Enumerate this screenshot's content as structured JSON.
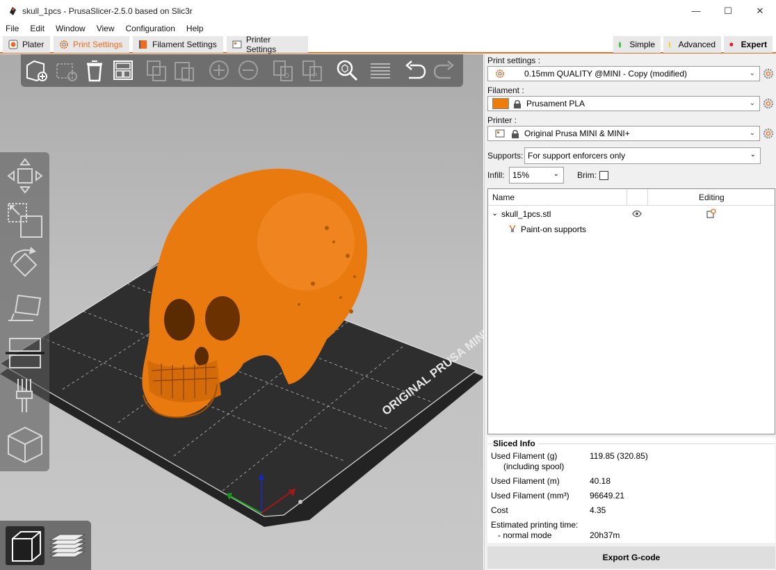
{
  "window": {
    "title": "skull_1pcs - PrusaSlicer-2.5.0 based on Slic3r",
    "minimize": "—",
    "maximize": "☐",
    "close": "✕"
  },
  "menu": [
    "File",
    "Edit",
    "Window",
    "View",
    "Configuration",
    "Help"
  ],
  "tabs": {
    "plater": "Plater",
    "print_settings": "Print Settings",
    "filament_settings": "Filament Settings",
    "printer_settings": "Printer Settings"
  },
  "modes": {
    "simple": "Simple",
    "advanced": "Advanced",
    "expert": "Expert",
    "colors": {
      "simple": "#3ec43e",
      "advanced": "#f2d21b",
      "expert": "#e01b24"
    }
  },
  "bed": {
    "label": "ORIGINAL PRUSA MINI"
  },
  "panel": {
    "print_settings_label": "Print settings :",
    "print_settings_value": "0.15mm QUALITY @MINI - Copy (modified)",
    "filament_label": "Filament :",
    "filament_value": "Prusament PLA",
    "filament_color": "#ed7d0a",
    "printer_label": "Printer :",
    "printer_value": "Original Prusa MINI & MINI+",
    "supports_label": "Supports:",
    "supports_value": "For support enforcers only",
    "infill_label": "Infill:",
    "infill_value": "15%",
    "brim_label": "Brim:",
    "brim_checked": false
  },
  "objects": {
    "col_name": "Name",
    "col_editing": "Editing",
    "items": [
      {
        "name": "skull_1pcs.stl",
        "icon": "eye-icon"
      },
      {
        "name": "Paint-on supports",
        "icon": "paint-supports-icon"
      }
    ]
  },
  "sliced_info": {
    "title": "Sliced Info",
    "used_filament_g_label": "Used Filament (g)",
    "used_filament_g_sub": "(including spool)",
    "used_filament_g_value": "119.85 (320.85)",
    "used_filament_m_label": "Used Filament (m)",
    "used_filament_m_value": "40.18",
    "used_filament_mm3_label": "Used Filament (mm³)",
    "used_filament_mm3_value": "96649.21",
    "cost_label": "Cost",
    "cost_value": "4.35",
    "est_time_label": "Estimated printing time:",
    "normal_mode_label": "- normal mode",
    "normal_mode_value": "20h37m"
  },
  "export_button": "Export G-code"
}
